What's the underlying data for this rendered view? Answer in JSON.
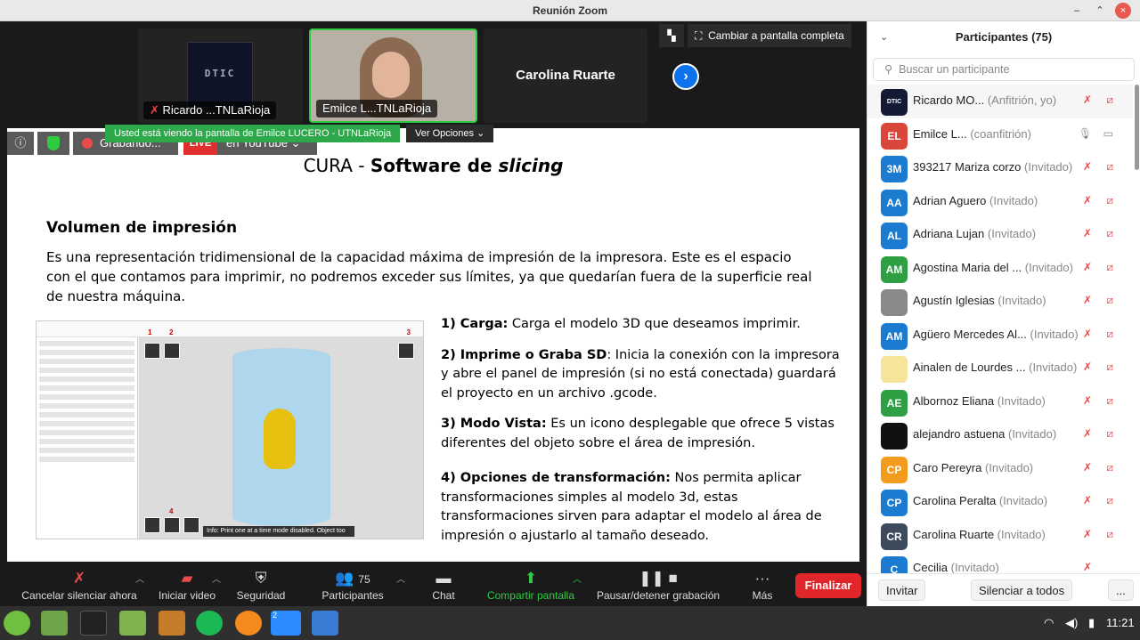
{
  "window": {
    "title": "Reunión Zoom"
  },
  "gallery": {
    "tiles": [
      {
        "name": "Ricardo ...TNLaRioja"
      },
      {
        "name": "Emilce L...TNLaRioja"
      },
      {
        "name": "Carolina Ruarte"
      }
    ],
    "logo_text": "DTIC",
    "fullscreen_label": "Cambiar a pantalla completa"
  },
  "banner": {
    "viewing_text": "Usted está viendo la pantalla de Emilce LUCERO - UTNLaRioja",
    "view_options": "Ver Opciones ⌄"
  },
  "meeting_status": {
    "recording": "Grabando...",
    "live": "LIVE",
    "youtube": "en YouTube ⌄"
  },
  "slide": {
    "title_regular": "CURA   -   ",
    "title_bold": "Software de ",
    "title_italic": "slicing",
    "section": "Volumen de impresión",
    "paragraph": "Es una representación tridimensional de la capacidad máxima de impresión de la impresora. Este es el espacio con el que contamos para imprimir, no podremos exceder sus límites, ya que quedarían fuera de la superficie real de nuestra máquina.",
    "items": [
      {
        "head": "1) Carga:",
        "text": " Carga el modelo 3D que deseamos imprimir."
      },
      {
        "head": "2) Imprime o Graba SD",
        "text": ": Inicia la conexión con la impresora y abre el panel de impresión (si no está conectada) guardará el proyecto en un archivo .gcode."
      },
      {
        "head": "3) Modo Vista:",
        "text": " Es un icono desplegable que ofrece 5 vistas diferentes del objeto sobre el área de impresión."
      },
      {
        "head": "4) Opciones de transformación:",
        "text": " Nos permita aplicar transformaciones simples al modelo 3d, estas transformaciones sirven para adaptar el modelo al área de impresión o ajustarlo al tamaño deseado."
      }
    ],
    "cura_toast": "Info: Print one at a time mode disabled. Object too tall.  X"
  },
  "toolbar": {
    "mute": "Cancelar silenciar ahora",
    "video": "Iniciar video",
    "security": "Seguridad",
    "participants": "Participantes",
    "participants_count": "75",
    "chat": "Chat",
    "share": "Compartir pantalla",
    "record": "Pausar/detener grabación",
    "more": "Más",
    "end": "Finalizar"
  },
  "participants_panel": {
    "title": "Participantes (75)",
    "search_placeholder": "Buscar un participante",
    "list": [
      {
        "initials": "DTIC",
        "name": "Ricardo MO...",
        "role": "(Anfitrión, yo)",
        "color": "#141a33"
      },
      {
        "initials": "EL",
        "name": "Emilce L...",
        "role": "(coanfitrión)",
        "color": "#d9473b"
      },
      {
        "initials": "3M",
        "name": "393217 Mariza corzo",
        "role": "(Invitado)",
        "color": "#1a7bd1"
      },
      {
        "initials": "AA",
        "name": "Adrian Aguero",
        "role": "(Invitado)",
        "color": "#1a7bd1"
      },
      {
        "initials": "AL",
        "name": "Adriana Lujan",
        "role": "(Invitado)",
        "color": "#1a7bd1"
      },
      {
        "initials": "AM",
        "name": "Agostina Maria del ...",
        "role": "(Invitado)",
        "color": "#2ea043"
      },
      {
        "initials": "",
        "name": "Agustín Iglesias",
        "role": "(Invitado)",
        "color": "#8a8a8a"
      },
      {
        "initials": "AM",
        "name": "Agüero Mercedes Al...",
        "role": "(Invitado)",
        "color": "#1a7bd1"
      },
      {
        "initials": "",
        "name": "Ainalen de Lourdes ...",
        "role": "(Invitado)",
        "color": "#f5e49a"
      },
      {
        "initials": "AE",
        "name": "Albornoz Eliana",
        "role": "(Invitado)",
        "color": "#2ea043"
      },
      {
        "initials": "",
        "name": "alejandro astuena",
        "role": "(Invitado)",
        "color": "#111111"
      },
      {
        "initials": "CP",
        "name": "Caro Pereyra",
        "role": "(Invitado)",
        "color": "#f29b1d"
      },
      {
        "initials": "CP",
        "name": "Carolina Peralta",
        "role": "(Invitado)",
        "color": "#1a7bd1"
      },
      {
        "initials": "CR",
        "name": "Carolina Ruarte",
        "role": "(Invitado)",
        "color": "#3d4a5c"
      },
      {
        "initials": "C",
        "name": "Cecilia",
        "role": "(Invitado)",
        "color": "#1a7bd1"
      }
    ],
    "invite": "Invitar",
    "mute_all": "Silenciar a todos",
    "more": "..."
  },
  "taskbar": {
    "time": "11:21",
    "badge": "2"
  }
}
